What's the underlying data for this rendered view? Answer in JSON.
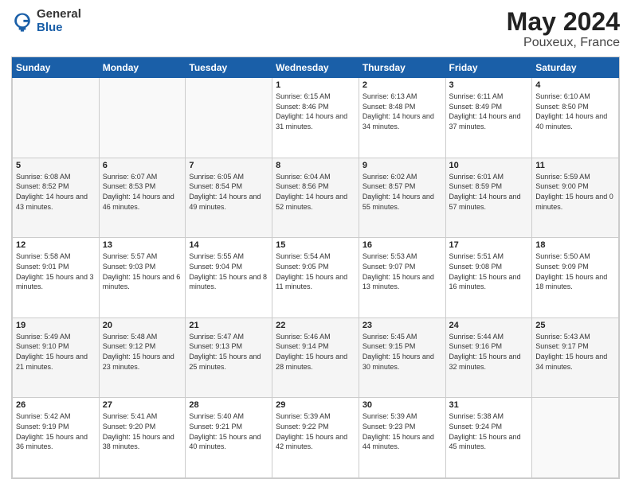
{
  "logo": {
    "general": "General",
    "blue": "Blue"
  },
  "title": "May 2024",
  "subtitle": "Pouxeux, France",
  "header_days": [
    "Sunday",
    "Monday",
    "Tuesday",
    "Wednesday",
    "Thursday",
    "Friday",
    "Saturday"
  ],
  "weeks": [
    [
      {
        "num": "",
        "sunrise": "",
        "sunset": "",
        "daylight": ""
      },
      {
        "num": "",
        "sunrise": "",
        "sunset": "",
        "daylight": ""
      },
      {
        "num": "",
        "sunrise": "",
        "sunset": "",
        "daylight": ""
      },
      {
        "num": "1",
        "sunrise": "Sunrise: 6:15 AM",
        "sunset": "Sunset: 8:46 PM",
        "daylight": "Daylight: 14 hours and 31 minutes."
      },
      {
        "num": "2",
        "sunrise": "Sunrise: 6:13 AM",
        "sunset": "Sunset: 8:48 PM",
        "daylight": "Daylight: 14 hours and 34 minutes."
      },
      {
        "num": "3",
        "sunrise": "Sunrise: 6:11 AM",
        "sunset": "Sunset: 8:49 PM",
        "daylight": "Daylight: 14 hours and 37 minutes."
      },
      {
        "num": "4",
        "sunrise": "Sunrise: 6:10 AM",
        "sunset": "Sunset: 8:50 PM",
        "daylight": "Daylight: 14 hours and 40 minutes."
      }
    ],
    [
      {
        "num": "5",
        "sunrise": "Sunrise: 6:08 AM",
        "sunset": "Sunset: 8:52 PM",
        "daylight": "Daylight: 14 hours and 43 minutes."
      },
      {
        "num": "6",
        "sunrise": "Sunrise: 6:07 AM",
        "sunset": "Sunset: 8:53 PM",
        "daylight": "Daylight: 14 hours and 46 minutes."
      },
      {
        "num": "7",
        "sunrise": "Sunrise: 6:05 AM",
        "sunset": "Sunset: 8:54 PM",
        "daylight": "Daylight: 14 hours and 49 minutes."
      },
      {
        "num": "8",
        "sunrise": "Sunrise: 6:04 AM",
        "sunset": "Sunset: 8:56 PM",
        "daylight": "Daylight: 14 hours and 52 minutes."
      },
      {
        "num": "9",
        "sunrise": "Sunrise: 6:02 AM",
        "sunset": "Sunset: 8:57 PM",
        "daylight": "Daylight: 14 hours and 55 minutes."
      },
      {
        "num": "10",
        "sunrise": "Sunrise: 6:01 AM",
        "sunset": "Sunset: 8:59 PM",
        "daylight": "Daylight: 14 hours and 57 minutes."
      },
      {
        "num": "11",
        "sunrise": "Sunrise: 5:59 AM",
        "sunset": "Sunset: 9:00 PM",
        "daylight": "Daylight: 15 hours and 0 minutes."
      }
    ],
    [
      {
        "num": "12",
        "sunrise": "Sunrise: 5:58 AM",
        "sunset": "Sunset: 9:01 PM",
        "daylight": "Daylight: 15 hours and 3 minutes."
      },
      {
        "num": "13",
        "sunrise": "Sunrise: 5:57 AM",
        "sunset": "Sunset: 9:03 PM",
        "daylight": "Daylight: 15 hours and 6 minutes."
      },
      {
        "num": "14",
        "sunrise": "Sunrise: 5:55 AM",
        "sunset": "Sunset: 9:04 PM",
        "daylight": "Daylight: 15 hours and 8 minutes."
      },
      {
        "num": "15",
        "sunrise": "Sunrise: 5:54 AM",
        "sunset": "Sunset: 9:05 PM",
        "daylight": "Daylight: 15 hours and 11 minutes."
      },
      {
        "num": "16",
        "sunrise": "Sunrise: 5:53 AM",
        "sunset": "Sunset: 9:07 PM",
        "daylight": "Daylight: 15 hours and 13 minutes."
      },
      {
        "num": "17",
        "sunrise": "Sunrise: 5:51 AM",
        "sunset": "Sunset: 9:08 PM",
        "daylight": "Daylight: 15 hours and 16 minutes."
      },
      {
        "num": "18",
        "sunrise": "Sunrise: 5:50 AM",
        "sunset": "Sunset: 9:09 PM",
        "daylight": "Daylight: 15 hours and 18 minutes."
      }
    ],
    [
      {
        "num": "19",
        "sunrise": "Sunrise: 5:49 AM",
        "sunset": "Sunset: 9:10 PM",
        "daylight": "Daylight: 15 hours and 21 minutes."
      },
      {
        "num": "20",
        "sunrise": "Sunrise: 5:48 AM",
        "sunset": "Sunset: 9:12 PM",
        "daylight": "Daylight: 15 hours and 23 minutes."
      },
      {
        "num": "21",
        "sunrise": "Sunrise: 5:47 AM",
        "sunset": "Sunset: 9:13 PM",
        "daylight": "Daylight: 15 hours and 25 minutes."
      },
      {
        "num": "22",
        "sunrise": "Sunrise: 5:46 AM",
        "sunset": "Sunset: 9:14 PM",
        "daylight": "Daylight: 15 hours and 28 minutes."
      },
      {
        "num": "23",
        "sunrise": "Sunrise: 5:45 AM",
        "sunset": "Sunset: 9:15 PM",
        "daylight": "Daylight: 15 hours and 30 minutes."
      },
      {
        "num": "24",
        "sunrise": "Sunrise: 5:44 AM",
        "sunset": "Sunset: 9:16 PM",
        "daylight": "Daylight: 15 hours and 32 minutes."
      },
      {
        "num": "25",
        "sunrise": "Sunrise: 5:43 AM",
        "sunset": "Sunset: 9:17 PM",
        "daylight": "Daylight: 15 hours and 34 minutes."
      }
    ],
    [
      {
        "num": "26",
        "sunrise": "Sunrise: 5:42 AM",
        "sunset": "Sunset: 9:19 PM",
        "daylight": "Daylight: 15 hours and 36 minutes."
      },
      {
        "num": "27",
        "sunrise": "Sunrise: 5:41 AM",
        "sunset": "Sunset: 9:20 PM",
        "daylight": "Daylight: 15 hours and 38 minutes."
      },
      {
        "num": "28",
        "sunrise": "Sunrise: 5:40 AM",
        "sunset": "Sunset: 9:21 PM",
        "daylight": "Daylight: 15 hours and 40 minutes."
      },
      {
        "num": "29",
        "sunrise": "Sunrise: 5:39 AM",
        "sunset": "Sunset: 9:22 PM",
        "daylight": "Daylight: 15 hours and 42 minutes."
      },
      {
        "num": "30",
        "sunrise": "Sunrise: 5:39 AM",
        "sunset": "Sunset: 9:23 PM",
        "daylight": "Daylight: 15 hours and 44 minutes."
      },
      {
        "num": "31",
        "sunrise": "Sunrise: 5:38 AM",
        "sunset": "Sunset: 9:24 PM",
        "daylight": "Daylight: 15 hours and 45 minutes."
      },
      {
        "num": "",
        "sunrise": "",
        "sunset": "",
        "daylight": ""
      }
    ]
  ]
}
